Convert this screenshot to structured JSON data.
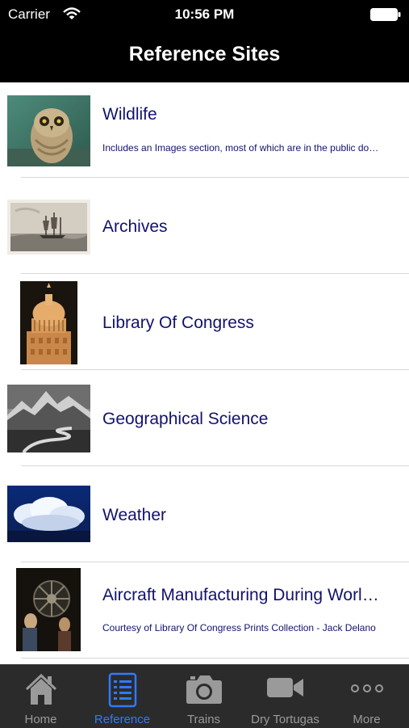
{
  "status_bar": {
    "carrier": "Carrier",
    "time": "10:56 PM"
  },
  "nav": {
    "title": "Reference Sites"
  },
  "rows": [
    {
      "title": "Wildlife",
      "subtitle": "Includes an Images section, most of which are in the public domain"
    },
    {
      "title": "Archives",
      "subtitle": ""
    },
    {
      "title": "Library Of Congress",
      "subtitle": ""
    },
    {
      "title": "Geographical Science",
      "subtitle": ""
    },
    {
      "title": "Weather",
      "subtitle": ""
    },
    {
      "title": "Aircraft Manufacturing During World War II",
      "subtitle": "Courtesy of Library Of Congress Prints Collection - Jack Delano"
    }
  ],
  "tabs": [
    {
      "label": "Home",
      "icon": "home-icon"
    },
    {
      "label": "Reference",
      "icon": "list-icon",
      "active": true
    },
    {
      "label": "Trains",
      "icon": "camera-icon"
    },
    {
      "label": "Dry Tortugas",
      "icon": "video-camera-icon"
    },
    {
      "label": "More",
      "icon": "more-icon"
    }
  ],
  "colors": {
    "accent": "#2f7bff",
    "title_text": "#12126e",
    "bar_bg": "#000000",
    "tab_bg": "#2b2b2b"
  }
}
